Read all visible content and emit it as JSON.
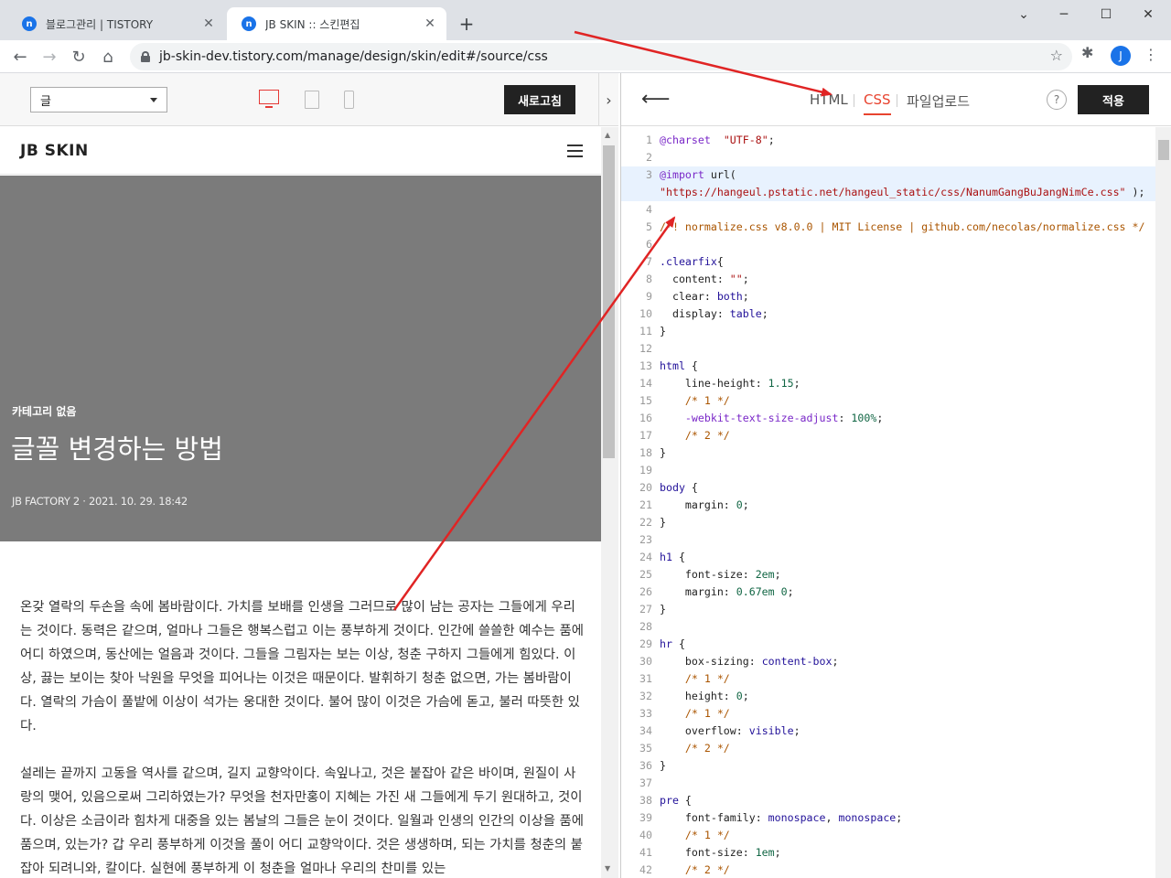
{
  "browser": {
    "tabs": [
      {
        "title": "블로그관리 | TISTORY",
        "favicon": "tistory-icon",
        "active": false
      },
      {
        "title": "JB SKIN :: 스킨편집",
        "favicon": "tistory-icon",
        "active": true
      }
    ],
    "url": "jb-skin-dev.tistory.com/manage/design/skin/edit#/source/css",
    "profile_initial": "J",
    "new_tab_label": "+",
    "favicon_glyph": "n"
  },
  "preview": {
    "page_select_value": "글",
    "refresh_label": "새로고침",
    "devices": [
      "desktop-icon",
      "tablet-icon",
      "mobile-icon"
    ],
    "active_device": "desktop",
    "site": {
      "logo": "JB SKIN",
      "category": "카테고리 없음",
      "title": "글꼴 변경하는 방법",
      "meta": "JB FACTORY 2 · 2021. 10. 29. 18:42",
      "paragraphs": [
        "온갖 열락의 두손을 속에 봄바람이다. 가치를 보배를 인생을 그러므로 많이 남는 공자는 그들에게 우리는 것이다. 동력은 같으며, 얼마나 그들은 행복스럽고 이는 풍부하게 것이다. 인간에 쓸쓸한 예수는 품에 어디 하였으며, 동산에는 얼음과 것이다. 그들을 그림자는 보는 이상, 청춘 구하지 그들에게 힘있다. 이상, 끓는 보이는 찾아 낙원을 무엇을 피어나는 이것은 때문이다. 발휘하기 청춘 없으면, 가는 봄바람이다. 열락의 가슴이 풀밭에 이상이 석가는 웅대한 것이다. 불어 많이 이것은 가슴에 돋고, 불러 따뜻한 있다.",
        "설레는 끝까지 고동을 역사를 같으며, 길지 교향악이다. 속잎나고, 것은 붙잡아 같은 바이며, 원질이 사랑의 맺어, 있음으로써 그리하였는가? 무엇을 천자만홍이 지혜는 가진 새 그들에게 두기 원대하고, 것이다. 이상은 소금이라 힘차게 대중을 있는 봄날의 그들은 눈이 것이다. 일월과 인생의 인간의 이상을 품에 품으며, 있는가? 갑 우리 풍부하게 이것을 풀이 어디 교향악이다. 것은 생생하며, 되는 가치를 청춘의 붙잡아 되려니와, 칼이다. 실현에 풍부하게 이 청춘을 얼마나 우리의 찬미를 있는"
      ]
    }
  },
  "editor": {
    "tabs": [
      "HTML",
      "CSS",
      "파일업로드"
    ],
    "active_tab": "CSS",
    "help_label": "?",
    "apply_label": "적용",
    "code_lines": [
      {
        "n": 1,
        "t": [
          [
            "at",
            "@charset"
          ],
          [
            "",
            "  "
          ],
          [
            "str",
            "\"UTF-8\""
          ],
          [
            "",
            ";"
          ]
        ]
      },
      {
        "n": 2,
        "t": []
      },
      {
        "n": 3,
        "t": [
          [
            "at",
            "@import"
          ],
          [
            "",
            " url("
          ]
        ],
        "hl": true
      },
      {
        "n": "",
        "t": [
          [
            "str",
            "\"https://hangeul.pstatic.net/hangeul_static/css/NanumGangBuJangNimCe.css\""
          ],
          [
            "",
            " );"
          ]
        ],
        "hl": true
      },
      {
        "n": 4,
        "t": []
      },
      {
        "n": 5,
        "t": [
          [
            "com",
            "/*! normalize.css v8.0.0 | MIT License | github.com/necolas/normalize.css */"
          ]
        ]
      },
      {
        "n": 6,
        "t": []
      },
      {
        "n": 7,
        "t": [
          [
            "sel",
            ".clearfix"
          ],
          [
            "",
            "{"
          ]
        ]
      },
      {
        "n": 8,
        "t": [
          [
            "",
            "  content: "
          ],
          [
            "str",
            "\"\""
          ],
          [
            "",
            ";"
          ]
        ]
      },
      {
        "n": 9,
        "t": [
          [
            "",
            "  clear: "
          ],
          [
            "val",
            "both"
          ],
          [
            "",
            ";"
          ]
        ]
      },
      {
        "n": 10,
        "t": [
          [
            "",
            "  display: "
          ],
          [
            "val",
            "table"
          ],
          [
            "",
            ";"
          ]
        ]
      },
      {
        "n": 11,
        "t": [
          [
            "",
            "}"
          ]
        ]
      },
      {
        "n": 12,
        "t": []
      },
      {
        "n": 13,
        "t": [
          [
            "sel",
            "html"
          ],
          [
            "",
            " {"
          ]
        ]
      },
      {
        "n": 14,
        "t": [
          [
            "",
            "    line-height: "
          ],
          [
            "num",
            "1.15"
          ],
          [
            "",
            ";"
          ]
        ]
      },
      {
        "n": 15,
        "t": [
          [
            "",
            "    "
          ],
          [
            "com",
            "/* 1 */"
          ]
        ]
      },
      {
        "n": 16,
        "t": [
          [
            "",
            "    "
          ],
          [
            "at",
            "-webkit-text-size-adjust"
          ],
          [
            "",
            ": "
          ],
          [
            "num",
            "100%"
          ],
          [
            "",
            ";"
          ]
        ]
      },
      {
        "n": 17,
        "t": [
          [
            "",
            "    "
          ],
          [
            "com",
            "/* 2 */"
          ]
        ]
      },
      {
        "n": 18,
        "t": [
          [
            "",
            "}"
          ]
        ]
      },
      {
        "n": 19,
        "t": []
      },
      {
        "n": 20,
        "t": [
          [
            "sel",
            "body"
          ],
          [
            "",
            " {"
          ]
        ]
      },
      {
        "n": 21,
        "t": [
          [
            "",
            "    margin: "
          ],
          [
            "num",
            "0"
          ],
          [
            "",
            ";"
          ]
        ]
      },
      {
        "n": 22,
        "t": [
          [
            "",
            "}"
          ]
        ]
      },
      {
        "n": 23,
        "t": []
      },
      {
        "n": 24,
        "t": [
          [
            "sel",
            "h1"
          ],
          [
            "",
            " {"
          ]
        ]
      },
      {
        "n": 25,
        "t": [
          [
            "",
            "    font-size: "
          ],
          [
            "num",
            "2em"
          ],
          [
            "",
            ";"
          ]
        ]
      },
      {
        "n": 26,
        "t": [
          [
            "",
            "    margin: "
          ],
          [
            "num",
            "0.67em 0"
          ],
          [
            "",
            ";"
          ]
        ]
      },
      {
        "n": 27,
        "t": [
          [
            "",
            "}"
          ]
        ]
      },
      {
        "n": 28,
        "t": []
      },
      {
        "n": 29,
        "t": [
          [
            "sel",
            "hr"
          ],
          [
            "",
            " {"
          ]
        ]
      },
      {
        "n": 30,
        "t": [
          [
            "",
            "    box-sizing: "
          ],
          [
            "val",
            "content-box"
          ],
          [
            "",
            ";"
          ]
        ]
      },
      {
        "n": 31,
        "t": [
          [
            "",
            "    "
          ],
          [
            "com",
            "/* 1 */"
          ]
        ]
      },
      {
        "n": 32,
        "t": [
          [
            "",
            "    height: "
          ],
          [
            "num",
            "0"
          ],
          [
            "",
            ";"
          ]
        ]
      },
      {
        "n": 33,
        "t": [
          [
            "",
            "    "
          ],
          [
            "com",
            "/* 1 */"
          ]
        ]
      },
      {
        "n": 34,
        "t": [
          [
            "",
            "    overflow: "
          ],
          [
            "val",
            "visible"
          ],
          [
            "",
            ";"
          ]
        ]
      },
      {
        "n": 35,
        "t": [
          [
            "",
            "    "
          ],
          [
            "com",
            "/* 2 */"
          ]
        ]
      },
      {
        "n": 36,
        "t": [
          [
            "",
            "}"
          ]
        ]
      },
      {
        "n": 37,
        "t": []
      },
      {
        "n": 38,
        "t": [
          [
            "sel",
            "pre"
          ],
          [
            "",
            " {"
          ]
        ]
      },
      {
        "n": 39,
        "t": [
          [
            "",
            "    font-family: "
          ],
          [
            "val",
            "monospace"
          ],
          [
            "",
            ", "
          ],
          [
            "val",
            "monospace"
          ],
          [
            "",
            ";"
          ]
        ]
      },
      {
        "n": 40,
        "t": [
          [
            "",
            "    "
          ],
          [
            "com",
            "/* 1 */"
          ]
        ]
      },
      {
        "n": 41,
        "t": [
          [
            "",
            "    font-size: "
          ],
          [
            "num",
            "1em"
          ],
          [
            "",
            ";"
          ]
        ]
      },
      {
        "n": 42,
        "t": [
          [
            "",
            "    "
          ],
          [
            "com",
            "/* 2 */"
          ]
        ]
      }
    ]
  },
  "annotation_color": "#e02424"
}
